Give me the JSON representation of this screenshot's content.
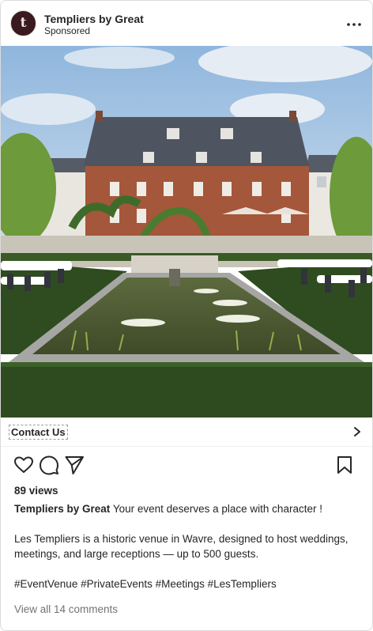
{
  "post": {
    "account_name": "Templiers by Great",
    "sponsored_label": "Sponsored",
    "avatar_mark": "t",
    "more_icon": "more-horizontal-icon"
  },
  "photo": {
    "subject": "historic-venue-photo",
    "colors": {
      "sky": "#a9c6e2",
      "roof": "#4e5560",
      "brick": "#a4573a",
      "hedge": "#2e4a1f",
      "water": "#4d5a32"
    }
  },
  "cta": {
    "label": "Contact Us",
    "icon": "chevron-right-icon"
  },
  "actions": {
    "like_icon": "heart-icon",
    "comment_icon": "comment-icon",
    "share_icon": "send-icon",
    "save_icon": "bookmark-icon"
  },
  "stats": {
    "views": "89 views"
  },
  "caption": {
    "author": "Templiers by Great",
    "line1": "Your event deserves a place with character !",
    "line2": "Les Templiers is a historic venue in Wavre, designed to host weddings, meetings, and large receptions — up to 500 guests.",
    "hashtags": "#EventVenue #PrivateEvents #Meetings #LesTempliers"
  },
  "comments": {
    "view_all": "View all 14 comments"
  }
}
